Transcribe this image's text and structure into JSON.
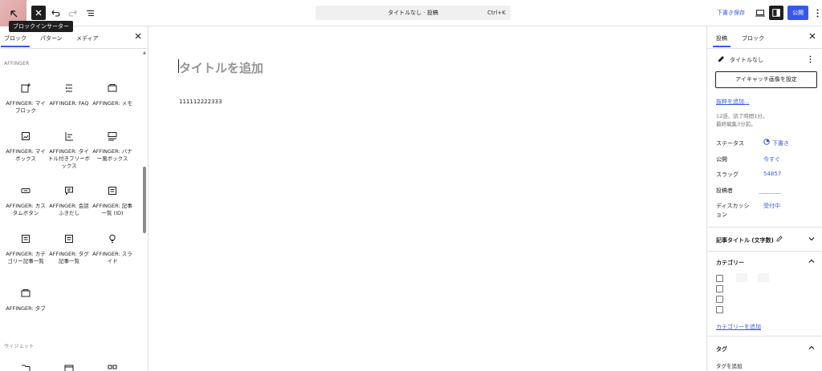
{
  "topbar": {
    "tooltip": "ブロックインサーター",
    "command_bar_title": "タイトルなし · 投稿",
    "command_bar_shortcut": "Ctrl+K",
    "save_draft": "下書き保存",
    "publish": "公開"
  },
  "inserter": {
    "tabs": [
      "ブロック",
      "パターン",
      "メディア"
    ],
    "category": "AFFINGER",
    "blocks": [
      {
        "label": "AFFINGER: マイブロック",
        "icon": "block-plus-icon"
      },
      {
        "label": "AFFINGER: FAQ",
        "icon": "faq-list-icon"
      },
      {
        "label": "AFFINGER: メモ",
        "icon": "memo-box-icon"
      },
      {
        "label": "AFFINGER: マイボックス",
        "icon": "image-box-icon"
      },
      {
        "label": "AFFINGER: タイトル付きフリーボックス",
        "icon": "titled-box-icon"
      },
      {
        "label": "AFFINGER: バナー風ボックス",
        "icon": "banner-box-icon"
      },
      {
        "label": "AFFINGER: カスタムボタン",
        "icon": "button-icon"
      },
      {
        "label": "AFFINGER: 会話ふきだし",
        "icon": "speech-bubble-icon"
      },
      {
        "label": "AFFINGER: 記事一覧 (ID)",
        "icon": "article-list-icon"
      },
      {
        "label": "AFFINGER: カテゴリー記事一覧",
        "icon": "category-list-icon"
      },
      {
        "label": "AFFINGER: タグ記事一覧",
        "icon": "tag-list-icon"
      },
      {
        "label": "AFFINGER: スライド",
        "icon": "slide-icon"
      },
      {
        "label": "AFFINGER: タブ",
        "icon": "tab-icon"
      }
    ],
    "widgets_heading": "ウィジェット"
  },
  "editor": {
    "title_placeholder": "タイトルを追加",
    "paragraph": "111112222333"
  },
  "sidebar": {
    "tabs": [
      "投稿",
      "ブロック"
    ],
    "post_title": "タイトルなし",
    "featured_image_button": "アイキャッチ画像を設定",
    "excerpt_link": "抜粋を追加...",
    "stats_line1": "12語、読了時間1分。",
    "stats_line2": "最終編集3分前。",
    "rows": [
      {
        "label": "ステータス",
        "value": "下書き"
      },
      {
        "label": "公開",
        "value": "今すぐ"
      },
      {
        "label": "スラッグ",
        "value": "54857"
      },
      {
        "label": "投稿者",
        "value": ""
      },
      {
        "label": "ディスカッション",
        "value": "受付中"
      }
    ],
    "article_title_panel": "記事タイトル (文字数)",
    "category_panel": "カテゴリー",
    "add_category": "カテゴリーを追加",
    "tag_panel": "タグ",
    "add_tag": "タグを追加"
  },
  "colors": {
    "accent": "#3858e9",
    "dark": "#1e1e1e",
    "muted": "#757575"
  }
}
